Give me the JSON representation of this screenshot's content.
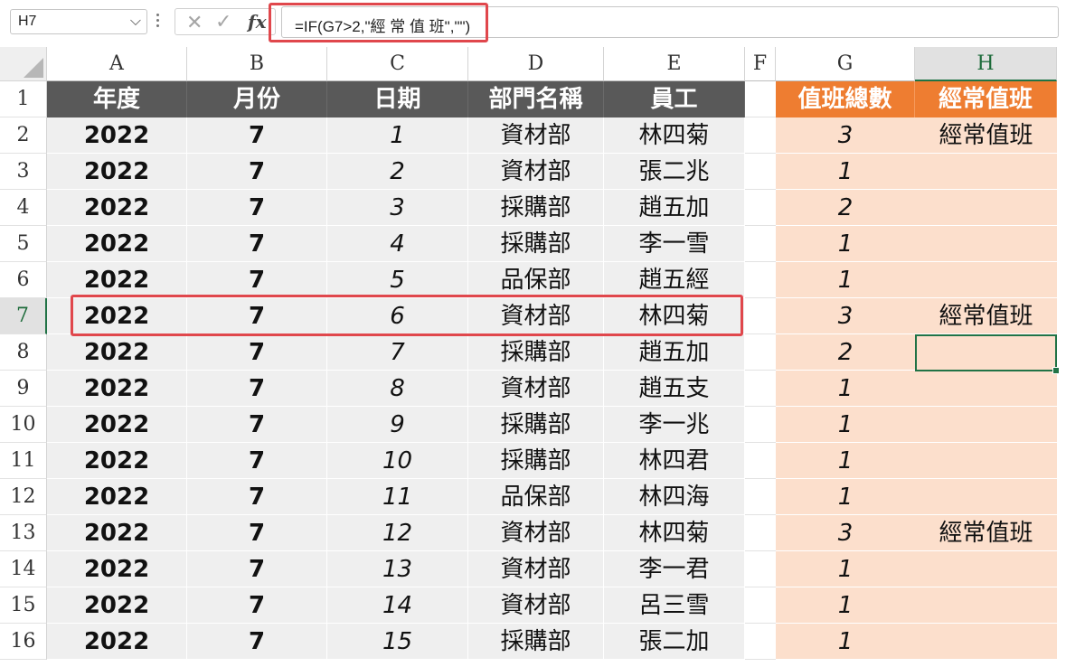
{
  "name_box": "H7",
  "name_box_arrow": "⌵",
  "formula_bar": {
    "cancel_icon": "✕",
    "enter_icon": "✓",
    "fx_label": "fx",
    "formula": "=IF(G7>2,\"經 常 值 班\",\"\")"
  },
  "columns": [
    "A",
    "B",
    "C",
    "D",
    "E",
    "F",
    "G",
    "H"
  ],
  "selected_column": "H",
  "selected_row": 7,
  "headers": {
    "A": "年度",
    "B": "月份",
    "C": "日期",
    "D": "部門名稱",
    "E": "員工",
    "G": "值班總數",
    "H": "經常值班"
  },
  "rows": [
    {
      "n": "1"
    },
    {
      "n": "2",
      "A": "2022",
      "B": "7",
      "C": "1",
      "D": "資材部",
      "E": "林四菊",
      "G": "3",
      "H": "經常值班"
    },
    {
      "n": "3",
      "A": "2022",
      "B": "7",
      "C": "2",
      "D": "資材部",
      "E": "張二兆",
      "G": "1",
      "H": ""
    },
    {
      "n": "4",
      "A": "2022",
      "B": "7",
      "C": "3",
      "D": "採購部",
      "E": "趙五加",
      "G": "2",
      "H": ""
    },
    {
      "n": "5",
      "A": "2022",
      "B": "7",
      "C": "4",
      "D": "採購部",
      "E": "李一雪",
      "G": "1",
      "H": ""
    },
    {
      "n": "6",
      "A": "2022",
      "B": "7",
      "C": "5",
      "D": "品保部",
      "E": "趙五經",
      "G": "1",
      "H": ""
    },
    {
      "n": "7",
      "A": "2022",
      "B": "7",
      "C": "6",
      "D": "資材部",
      "E": "林四菊",
      "G": "3",
      "H": "經常值班"
    },
    {
      "n": "8",
      "A": "2022",
      "B": "7",
      "C": "7",
      "D": "採購部",
      "E": "趙五加",
      "G": "2",
      "H": ""
    },
    {
      "n": "9",
      "A": "2022",
      "B": "7",
      "C": "8",
      "D": "資材部",
      "E": "趙五支",
      "G": "1",
      "H": ""
    },
    {
      "n": "10",
      "A": "2022",
      "B": "7",
      "C": "9",
      "D": "採購部",
      "E": "李一兆",
      "G": "1",
      "H": ""
    },
    {
      "n": "11",
      "A": "2022",
      "B": "7",
      "C": "10",
      "D": "採購部",
      "E": "林四君",
      "G": "1",
      "H": ""
    },
    {
      "n": "12",
      "A": "2022",
      "B": "7",
      "C": "11",
      "D": "品保部",
      "E": "林四海",
      "G": "1",
      "H": ""
    },
    {
      "n": "13",
      "A": "2022",
      "B": "7",
      "C": "12",
      "D": "資材部",
      "E": "林四菊",
      "G": "3",
      "H": "經常值班"
    },
    {
      "n": "14",
      "A": "2022",
      "B": "7",
      "C": "13",
      "D": "資材部",
      "E": "李一君",
      "G": "1",
      "H": ""
    },
    {
      "n": "15",
      "A": "2022",
      "B": "7",
      "C": "14",
      "D": "資材部",
      "E": "呂三雪",
      "G": "1",
      "H": ""
    },
    {
      "n": "16",
      "A": "2022",
      "B": "7",
      "C": "15",
      "D": "採購部",
      "E": "張二加",
      "G": "1",
      "H": ""
    }
  ],
  "colors": {
    "header_dark": "#595959",
    "header_orange": "#ee7d31",
    "data_gray": "#efefef",
    "data_peach": "#fcdfcc",
    "highlight_red": "#e0474c",
    "selection_green": "#217346"
  }
}
